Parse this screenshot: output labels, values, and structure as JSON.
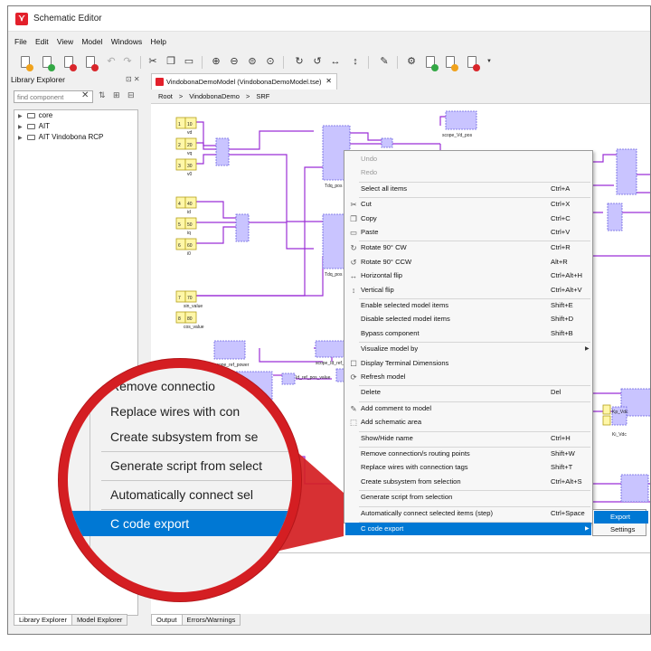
{
  "window": {
    "title": "Schematic Editor"
  },
  "menubar": [
    "File",
    "Edit",
    "View",
    "Model",
    "Windows",
    "Help"
  ],
  "library": {
    "title": "Library Explorer",
    "search_placeholder": "find component",
    "items": [
      "core",
      "AIT",
      "AIT Vindobona RCP"
    ],
    "tabs": [
      "Library Explorer",
      "Model Explorer"
    ]
  },
  "editor": {
    "tab_label": "VindobonaDemoModel (VindobonaDemoModel.tse)",
    "breadcrumb": [
      "Root",
      ">",
      "VindobonaDemo",
      ">",
      "SRF"
    ]
  },
  "output_tabs": [
    "Output",
    "Errors/Warnings"
  ],
  "diagram": {
    "inputs": [
      "1",
      "2",
      "3",
      "4",
      "5",
      "6",
      "7",
      "8"
    ],
    "const_values": [
      "10",
      "20",
      "30",
      "40",
      "50",
      "60",
      "70",
      "80"
    ],
    "labels": [
      "vd",
      "vq",
      "v0",
      "id",
      "iq",
      "i0",
      "sin_value",
      "cos_value",
      "scope_Vd_pos",
      "scope_ref_power",
      "scope_Id_ref_pos",
      "Id_ref_pos_value",
      "Ki_Vdc",
      "Kp_Vdc",
      "Tdq_pos",
      "Tdq_pos"
    ]
  },
  "context_menu": {
    "items": [
      {
        "label": "Undo",
        "shortcut": "",
        "icon": "",
        "disabled": true
      },
      {
        "label": "Redo",
        "shortcut": "",
        "icon": "",
        "disabled": true
      },
      {
        "sep": true
      },
      {
        "label": "Select all items",
        "shortcut": "Ctrl+A",
        "icon": ""
      },
      {
        "sep": true
      },
      {
        "label": "Cut",
        "shortcut": "Ctrl+X",
        "icon": "scissors-icon"
      },
      {
        "label": "Copy",
        "shortcut": "Ctrl+C",
        "icon": "copy-icon"
      },
      {
        "label": "Paste",
        "shortcut": "Ctrl+V",
        "icon": "paste-icon"
      },
      {
        "sep": true
      },
      {
        "label": "Rotate 90° CW",
        "shortcut": "Ctrl+R",
        "icon": "rotate-cw-icon"
      },
      {
        "label": "Rotate 90° CCW",
        "shortcut": "Alt+R",
        "icon": "rotate-ccw-icon"
      },
      {
        "label": "Horizontal flip",
        "shortcut": "Ctrl+Alt+H",
        "icon": "flip-horizontal-icon"
      },
      {
        "label": "Vertical flip",
        "shortcut": "Ctrl+Alt+V",
        "icon": "flip-vertical-icon"
      },
      {
        "sep": true
      },
      {
        "label": "Enable selected model items",
        "shortcut": "Shift+E",
        "icon": ""
      },
      {
        "label": "Disable selected model items",
        "shortcut": "Shift+D",
        "icon": ""
      },
      {
        "label": "Bypass component",
        "shortcut": "Shift+B",
        "icon": ""
      },
      {
        "sep": true
      },
      {
        "label": "Visualize model by",
        "shortcut": "",
        "icon": "",
        "submenu": true
      },
      {
        "label": "Display Terminal Dimensions",
        "shortcut": "",
        "icon": "checkbox-icon"
      },
      {
        "label": "Refresh model",
        "shortcut": "",
        "icon": "refresh-icon"
      },
      {
        "sep": true
      },
      {
        "label": "Delete",
        "shortcut": "Del",
        "icon": ""
      },
      {
        "sep": true
      },
      {
        "label": "Add comment to model",
        "shortcut": "",
        "icon": "comment-icon"
      },
      {
        "label": "Add schematic area",
        "shortcut": "",
        "icon": "area-icon"
      },
      {
        "sep": true
      },
      {
        "label": "Show/Hide name",
        "shortcut": "Ctrl+H",
        "icon": ""
      },
      {
        "sep": true
      },
      {
        "label": "Remove connection/s routing points",
        "shortcut": "Shift+W",
        "icon": ""
      },
      {
        "label": "Replace wires with connection tags",
        "shortcut": "Shift+T",
        "icon": ""
      },
      {
        "label": "Create subsystem from selection",
        "shortcut": "Ctrl+Alt+S",
        "icon": ""
      },
      {
        "sep": true
      },
      {
        "label": "Generate script from selection",
        "shortcut": "",
        "icon": ""
      },
      {
        "sep": true
      },
      {
        "label": "Automatically connect selected items (step)",
        "shortcut": "Ctrl+Space",
        "icon": ""
      },
      {
        "sep": true
      },
      {
        "label": "C code export",
        "shortcut": "",
        "icon": "",
        "submenu": true,
        "highlighted": true
      }
    ]
  },
  "submenu": {
    "items": [
      "Export",
      "Settings"
    ]
  },
  "magnifier": {
    "items": [
      "Remove connectio",
      "Replace wires with con",
      "Create subsystem from se",
      "Generate script from select",
      "Automatically connect sel",
      "C code export"
    ]
  }
}
